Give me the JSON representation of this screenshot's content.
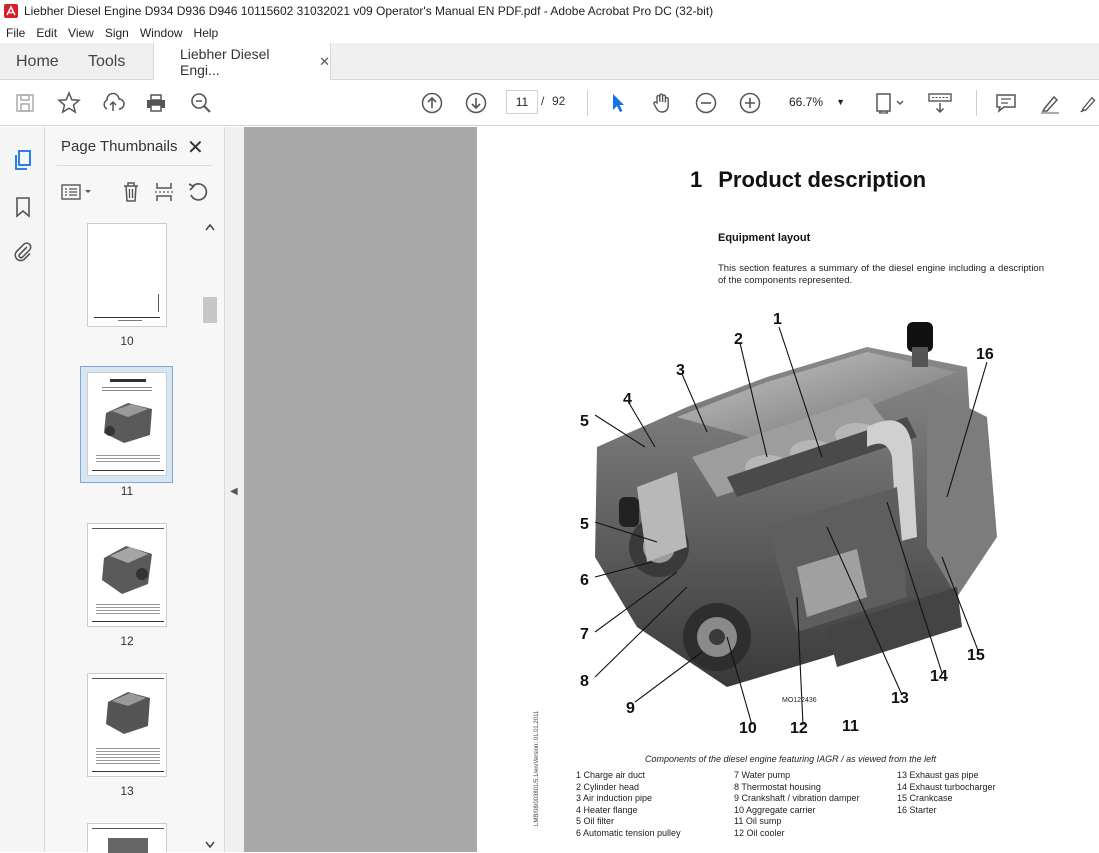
{
  "window": {
    "title": "Liebher Diesel Engine D934 D936 D946 10115602 31032021 v09 Operator's Manual EN PDF.pdf - Adobe Acrobat Pro DC (32-bit)"
  },
  "menu": [
    "File",
    "Edit",
    "View",
    "Sign",
    "Window",
    "Help"
  ],
  "tabs": {
    "home": "Home",
    "tools": "Tools",
    "document": "Liebher Diesel Engi...",
    "close_glyph": "✕"
  },
  "toolbar": {
    "current_page": "11",
    "page_sep": "/",
    "total_pages": "92",
    "zoom": "66.7%"
  },
  "panel": {
    "title": "Page Thumbnails",
    "close_glyph": "✕",
    "thumbnails": [
      {
        "label": "10"
      },
      {
        "label": "11"
      },
      {
        "label": "12"
      },
      {
        "label": "13"
      }
    ]
  },
  "document": {
    "chapter_number": "1",
    "chapter_title": "Product description",
    "section_title": "Equipment layout",
    "intro": "This section features a summary of the diesel engine including a description of the components represented.",
    "side_note": "LMB/08/003801/5.1/en/Version: 01.01.2011",
    "figure_id": "MO122436",
    "caption": "Components of the diesel engine featuring IAGR / as viewed from the left",
    "callouts": [
      "1",
      "2",
      "3",
      "4",
      "5",
      "5",
      "6",
      "7",
      "8",
      "9",
      "10",
      "12",
      "11",
      "13",
      "14",
      "15",
      "16"
    ],
    "legend": [
      [
        "1 Charge air duct",
        "2 Cylinder head",
        "3 Air induction pipe",
        "4 Heater flange",
        "5 Oil filter",
        "6 Automatic tension pulley"
      ],
      [
        "7 Water pump",
        "8 Thermostat housing",
        "9 Crankshaft / vibration damper",
        "10 Aggregate carrier",
        "11 Oil sump",
        "12 Oil cooler"
      ],
      [
        "13 Exhaust gas pipe",
        "14 Exhaust turbocharger",
        "15 Crankcase",
        "16 Starter"
      ]
    ]
  }
}
